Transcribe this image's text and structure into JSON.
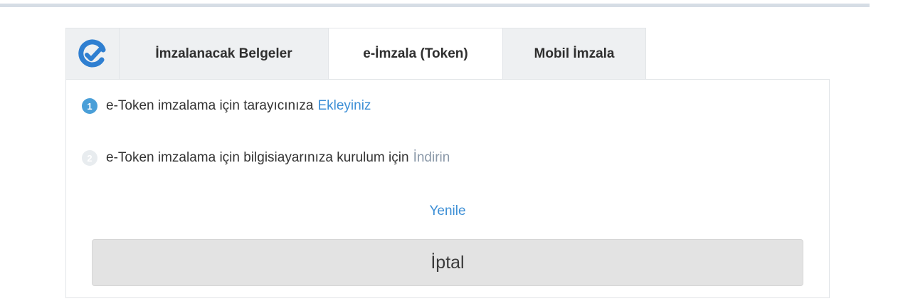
{
  "tabs": {
    "logo_icon": "e-signature-check-logo-icon",
    "items": [
      {
        "label": "İmzalanacak Belgeler",
        "active": false
      },
      {
        "label": "e-İmzala (Token)",
        "active": true
      },
      {
        "label": "Mobil İmzala",
        "active": false
      }
    ]
  },
  "steps": [
    {
      "number": "1",
      "text": "e-Token imzalama için tarayıcınıza",
      "link": "Ekleyiniz",
      "state": "active"
    },
    {
      "number": "2",
      "text": "e-Token imzalama için bilgisiayarınıza kurulum için",
      "link": "İndirin",
      "state": "inactive"
    }
  ],
  "refresh_label": "Yenile",
  "cancel_label": "İptal",
  "colors": {
    "accent": "#3d8fd6",
    "logo": "#2f7fd1",
    "step_active": "#4a9fd8",
    "step_inactive": "#e8ecef",
    "button_bg": "#e3e3e3"
  }
}
